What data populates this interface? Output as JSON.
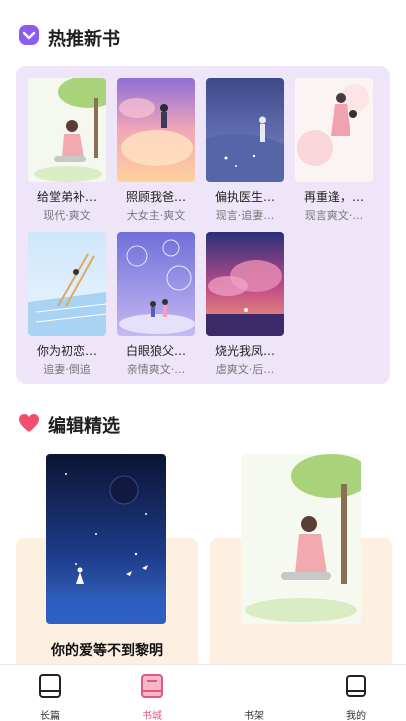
{
  "sections": {
    "hot": {
      "title": "热推新书",
      "icon": "heart-badge-icon",
      "accent": "#8a5cf0"
    },
    "editor": {
      "title": "编辑精选",
      "icon": "heart-icon",
      "accent": "#f0506e"
    }
  },
  "hot_books": [
    {
      "title": "给堂弟补…",
      "tags": "现代·爽文"
    },
    {
      "title": "照顾我爸…",
      "tags": "大女主·爽文"
    },
    {
      "title": "偏执医生…",
      "tags": "现言·追妻…"
    },
    {
      "title": "再重逢，…",
      "tags": "现言爽文·…"
    },
    {
      "title": "你为初恋…",
      "tags": "追妻·倒追"
    },
    {
      "title": "白眼狼父…",
      "tags": "亲情爽文·…"
    },
    {
      "title": "烧光我凤…",
      "tags": "虐爽文·后…"
    }
  ],
  "editor_books": [
    {
      "title": "你的爱等不到黎明"
    }
  ],
  "tabs": [
    {
      "label": "长篇",
      "icon": "book-icon",
      "active": false
    },
    {
      "label": "书城",
      "icon": "bookstore-icon",
      "active": true
    },
    {
      "label": "书架",
      "icon": "bookshelf-icon",
      "active": false
    },
    {
      "label": "我的",
      "icon": "profile-icon",
      "active": false
    }
  ],
  "colors": {
    "panel": "#eee6f8",
    "editor_card": "#fdf0e1",
    "active_tab": "#e05a80"
  }
}
